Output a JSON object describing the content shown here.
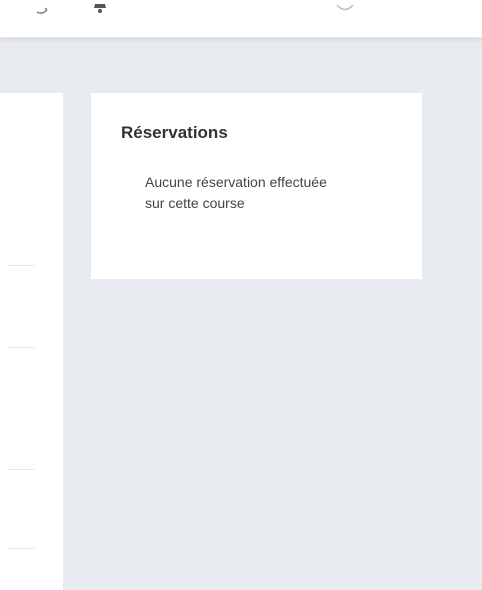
{
  "header": {
    "icons": [
      "satellite-dish-icon",
      "bell-icon",
      "avatar-icon"
    ]
  },
  "reservations": {
    "title": "Réservations",
    "empty_message": "Aucune réservation effectuée sur cette course"
  },
  "colors": {
    "background": "#e8ebef",
    "card": "#ffffff",
    "title_text": "#333333",
    "body_text": "#444444"
  }
}
